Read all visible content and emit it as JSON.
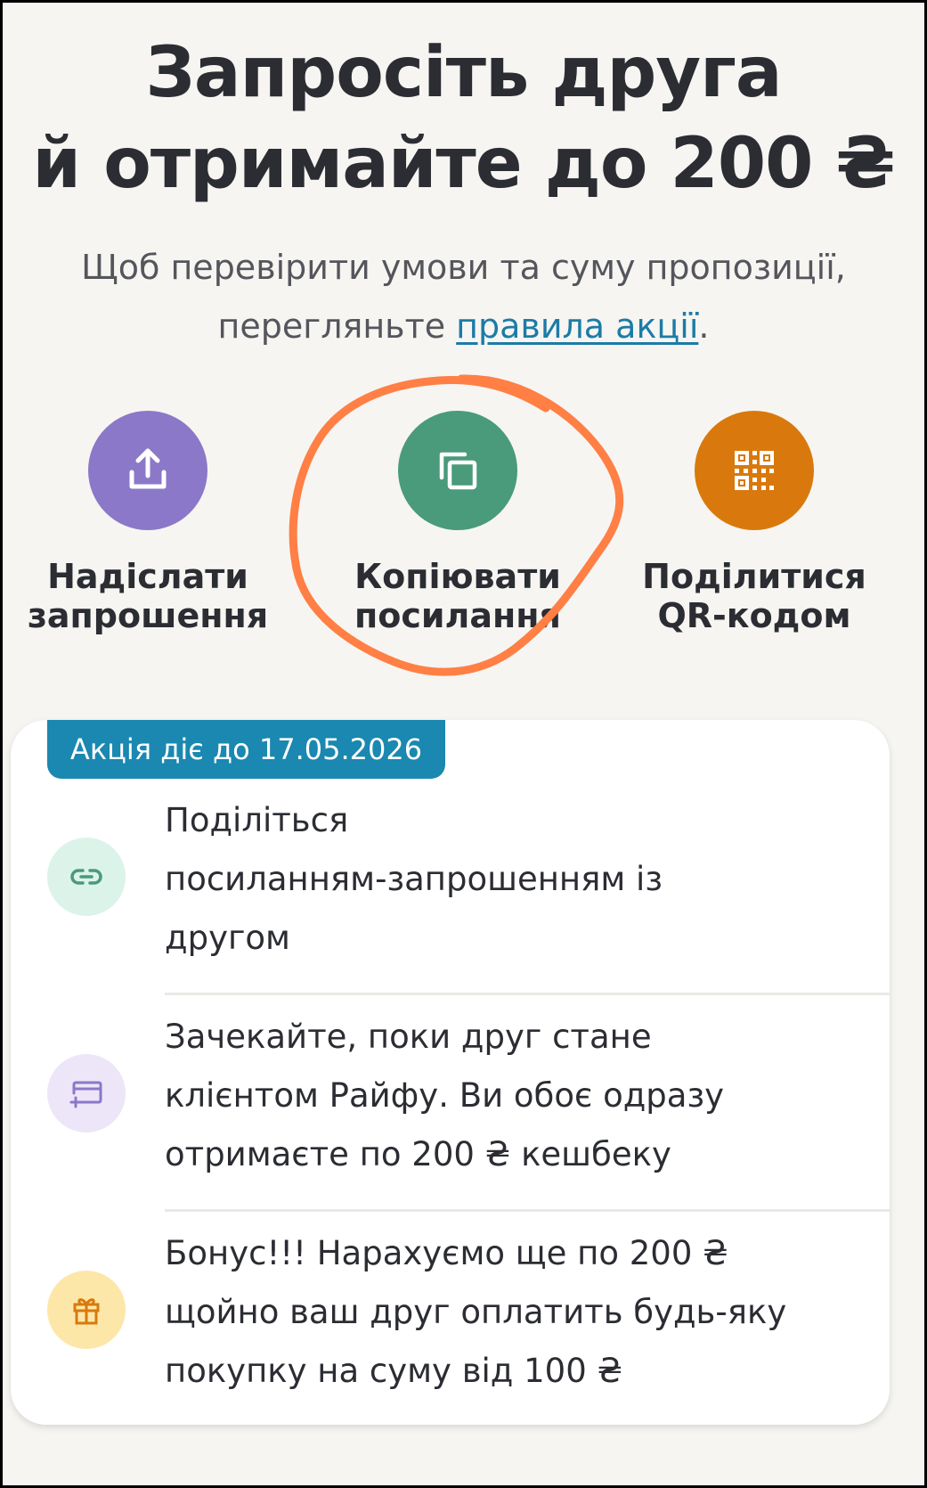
{
  "header": {
    "title_line1": "Запросіть друга",
    "title_line2": "й отримайте до 200 ₴",
    "subtitle_line1": "Щоб перевірити умови та суму пропозиції,",
    "subtitle_line2_prefix": "перегляньте ",
    "subtitle_link": "правила акції",
    "subtitle_line2_suffix": "."
  },
  "actions": [
    {
      "line1": "Надіслати",
      "line2": "запрошення",
      "color": "#8b78c8",
      "icon": "share-icon"
    },
    {
      "line1": "Копіювати",
      "line2": "посилання",
      "color": "#4a9a7c",
      "icon": "copy-icon"
    },
    {
      "line1": "Поділитися",
      "line2": "QR-кодом",
      "color": "#d9790d",
      "icon": "qr-code-icon"
    }
  ],
  "highlight_color": "#ff7f45",
  "promo": {
    "badge": "Акція діє до 17.05.2026",
    "badge_color": "#1a88b0",
    "steps": [
      {
        "line1": "Поділіться",
        "line2": "посиланням-запрошенням із",
        "line3": "другом",
        "icon": "link-icon",
        "icon_bg": "#dcf3ea",
        "icon_color": "#4a9a7c"
      },
      {
        "line1": "Зачекайте, поки друг стане",
        "line2": "клієнтом Райфу. Ви обоє одразу",
        "line3": "отримаєте по 200 ₴ кешбеку",
        "icon": "new-card-icon",
        "icon_bg": "#ece6f8",
        "icon_color": "#8b78c8"
      },
      {
        "line1": "Бонус!!! Нарахуємо ще по 200 ₴",
        "line2": "щойно ваш друг оплатить будь-яку",
        "line3": "покупку на суму від 100 ₴",
        "icon": "gift-icon",
        "icon_bg": "#fde7a8",
        "icon_color": "#d9790d"
      }
    ]
  }
}
